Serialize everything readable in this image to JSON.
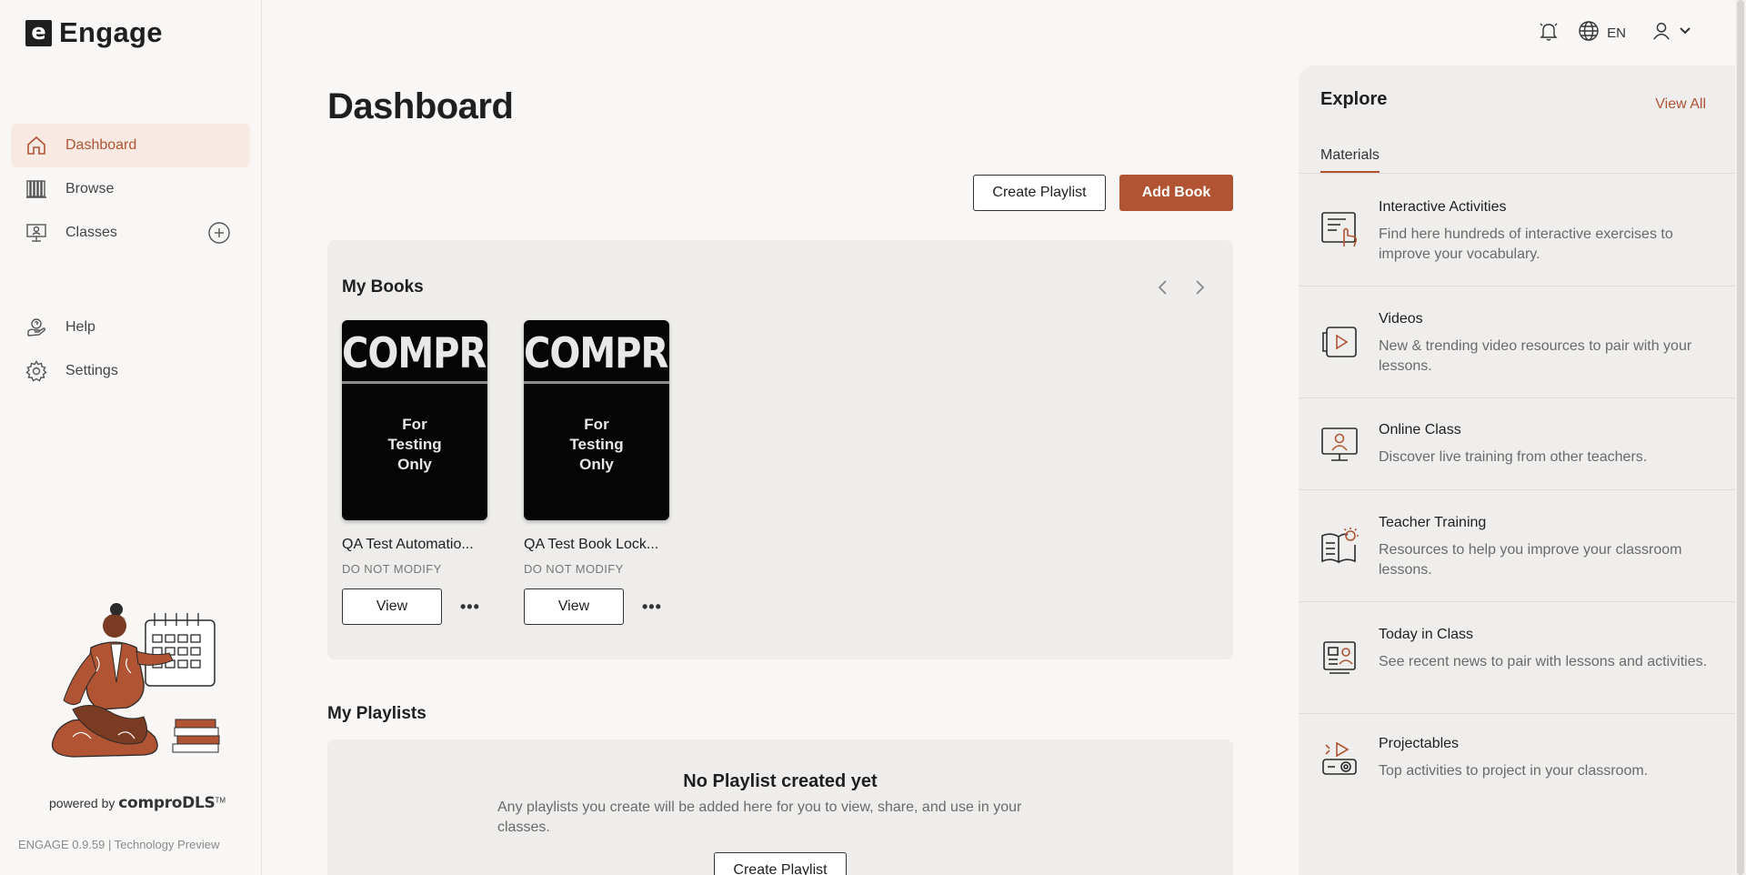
{
  "app": {
    "logo_letter": "e",
    "name": "Engage"
  },
  "sidebar": {
    "items": [
      {
        "label": "Dashboard",
        "icon": "home-icon",
        "active": true
      },
      {
        "label": "Browse",
        "icon": "bookshelf-icon"
      },
      {
        "label": "Classes",
        "icon": "classroom-icon"
      },
      {
        "label": "Help",
        "icon": "help-icon"
      },
      {
        "label": "Settings",
        "icon": "gear-icon"
      }
    ],
    "powered_by": "powered by",
    "brand": "comproDLS",
    "brand_tm": "TM",
    "version": "ENGAGE 0.9.59 | Technology Preview"
  },
  "header": {
    "language": "EN"
  },
  "main": {
    "title": "Dashboard",
    "create_playlist": "Create Playlist",
    "add_book": "Add Book",
    "my_books": {
      "title": "My Books",
      "books": [
        {
          "cover_title": "COMPRO",
          "cover_subtitle": "For Testing Only",
          "cover_line1": "For",
          "cover_line2": "Testing",
          "cover_line3": "Only",
          "title": "QA Test Automatio...",
          "subtitle": "DO NOT MODIFY",
          "view_label": "View"
        },
        {
          "cover_title": "COMPRO",
          "cover_subtitle": "For Testing Only",
          "cover_line1": "For",
          "cover_line2": "Testing",
          "cover_line3": "Only",
          "title": "QA Test Book Lock...",
          "subtitle": "DO NOT MODIFY",
          "view_label": "View"
        }
      ]
    },
    "my_playlists": {
      "title": "My Playlists",
      "empty_title": "No Playlist created yet",
      "empty_text": "Any playlists you create will be added here for you to view, share, and use in your classes.",
      "create_label": "Create Playlist"
    }
  },
  "explore": {
    "title": "Explore",
    "view_all": "View All",
    "tab": "Materials",
    "items": [
      {
        "title": "Interactive Activities",
        "desc": "Find here hundreds of interactive exercises to improve your vocabulary.",
        "icon": "interactive-activities-icon"
      },
      {
        "title": "Videos",
        "desc": "New & trending video resources to pair with your lessons.",
        "icon": "video-icon"
      },
      {
        "title": "Online Class",
        "desc": "Discover live training from other teachers.",
        "icon": "online-class-icon"
      },
      {
        "title": "Teacher Training",
        "desc": "Resources to help you improve your classroom lessons.",
        "icon": "teacher-training-icon"
      },
      {
        "title": "Today in Class",
        "desc": "See recent news to pair with lessons and activities.",
        "icon": "today-in-class-icon"
      },
      {
        "title": "Projectables",
        "desc": "Top activities to project in your classroom.",
        "icon": "projector-icon"
      }
    ]
  },
  "colors": {
    "accent": "#b05433",
    "active_bg": "#f8e9e3",
    "panel_bg": "#eeedeb",
    "page_bg": "#f8f7f5"
  }
}
